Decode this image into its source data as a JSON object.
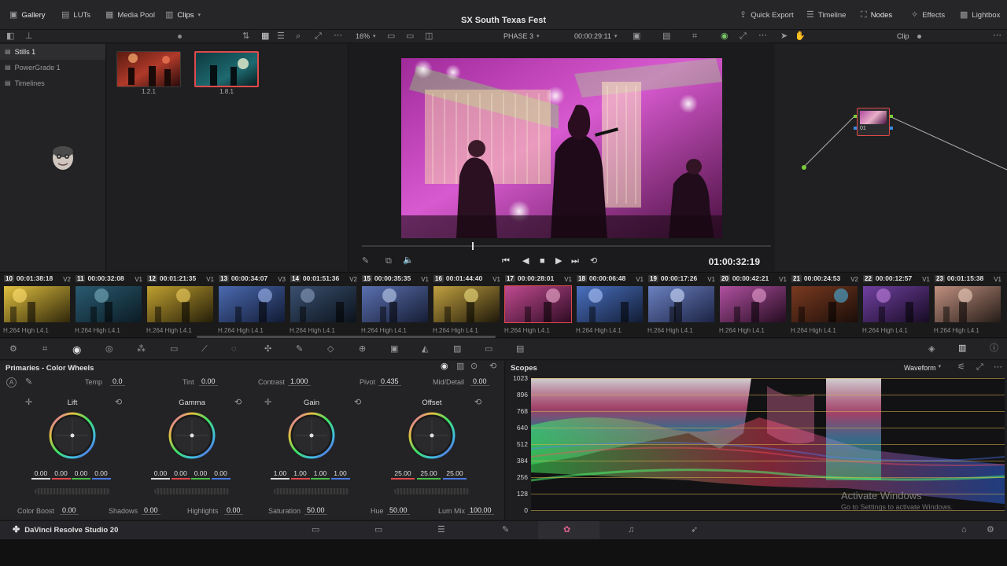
{
  "topbar": {
    "gallery": "Gallery",
    "luts": "LUTs",
    "media_pool": "Media Pool",
    "clips": "Clips",
    "title": "SX South Texas Fest",
    "quick_export": "Quick Export",
    "timeline": "Timeline",
    "nodes": "Nodes",
    "effects": "Effects",
    "lightbox": "Lightbox"
  },
  "toolbar": {
    "zoom": "16%",
    "phase": "PHASE 3",
    "source_tc": "00:00:29:11",
    "node_mode": "Clip"
  },
  "sidebar": {
    "items": [
      {
        "label": "Stills 1"
      },
      {
        "label": "PowerGrade 1"
      },
      {
        "label": "Timelines"
      }
    ]
  },
  "stills": [
    {
      "label": "1.2.1"
    },
    {
      "label": "1.8.1"
    }
  ],
  "viewer": {
    "timecode": "01:00:32:19"
  },
  "node": {
    "label": "01"
  },
  "clips": [
    {
      "num": "10",
      "tc": "00:01:38:18",
      "track": "V2",
      "codec": "H.264 High L4.1"
    },
    {
      "num": "11",
      "tc": "00:00:32:08",
      "track": "V1",
      "codec": "H.264 High L4.1"
    },
    {
      "num": "12",
      "tc": "00:01:21:35",
      "track": "V1",
      "codec": "H.264 High L4.1"
    },
    {
      "num": "13",
      "tc": "00:00:34:07",
      "track": "V3",
      "codec": "H.264 High L4.1"
    },
    {
      "num": "14",
      "tc": "00:01:51:36",
      "track": "V2",
      "codec": "H.264 High L4.1"
    },
    {
      "num": "15",
      "tc": "00:00:35:35",
      "track": "V1",
      "codec": "H.264 High L4.1"
    },
    {
      "num": "16",
      "tc": "00:01:44:40",
      "track": "V1",
      "codec": "H.264 High L4.1"
    },
    {
      "num": "17",
      "tc": "00:00:28:01",
      "track": "V1",
      "codec": "H.264 High L4.1"
    },
    {
      "num": "18",
      "tc": "00:00:06:48",
      "track": "V1",
      "codec": "H.264 High L4.1"
    },
    {
      "num": "19",
      "tc": "00:00:17:26",
      "track": "V1",
      "codec": "H.264 High L4.1"
    },
    {
      "num": "20",
      "tc": "00:00:42:21",
      "track": "V1",
      "codec": "H.264 High L4.1"
    },
    {
      "num": "21",
      "tc": "00:00:24:53",
      "track": "V2",
      "codec": "H.264 High L4.1"
    },
    {
      "num": "22",
      "tc": "00:00:12:57",
      "track": "V1",
      "codec": "H.264 High L4.1"
    },
    {
      "num": "23",
      "tc": "00:01:15:38",
      "track": "V1",
      "codec": "H.264 High L4.1"
    }
  ],
  "primaries": {
    "title": "Primaries - Color Wheels",
    "temp_label": "Temp",
    "temp": "0.0",
    "tint_label": "Tint",
    "tint": "0.00",
    "contrast_label": "Contrast",
    "contrast": "1.000",
    "pivot_label": "Pivot",
    "pivot": "0.435",
    "middetail_label": "Mid/Detail",
    "middetail": "0.00",
    "wheels": [
      {
        "name": "Lift",
        "values": [
          "0.00",
          "0.00",
          "0.00",
          "0.00"
        ]
      },
      {
        "name": "Gamma",
        "values": [
          "0.00",
          "0.00",
          "0.00",
          "0.00"
        ]
      },
      {
        "name": "Gain",
        "values": [
          "1.00",
          "1.00",
          "1.00",
          "1.00"
        ]
      },
      {
        "name": "Offset",
        "values": [
          "25.00",
          "25.00",
          "25.00"
        ]
      }
    ],
    "colorboost_label": "Color Boost",
    "colorboost": "0.00",
    "shadows_label": "Shadows",
    "shadows": "0.00",
    "highlights_label": "Highlights",
    "highlights": "0.00",
    "saturation_label": "Saturation",
    "saturation": "50.00",
    "hue_label": "Hue",
    "hue": "50.00",
    "lummix_label": "Lum Mix",
    "lummix": "100.00"
  },
  "scopes": {
    "title": "Scopes",
    "mode": "Waveform",
    "scale": [
      "1023",
      "896",
      "768",
      "640",
      "512",
      "384",
      "256",
      "128",
      "0"
    ],
    "watermark_title": "Activate Windows",
    "watermark_sub": "Go to Settings to activate Windows."
  },
  "bottombar": {
    "app": "DaVinci Resolve Studio 20"
  },
  "colors": {
    "accent_red": "#e04a4a",
    "scope_line": "#d8b64a",
    "bg": "#1c1c1e"
  }
}
